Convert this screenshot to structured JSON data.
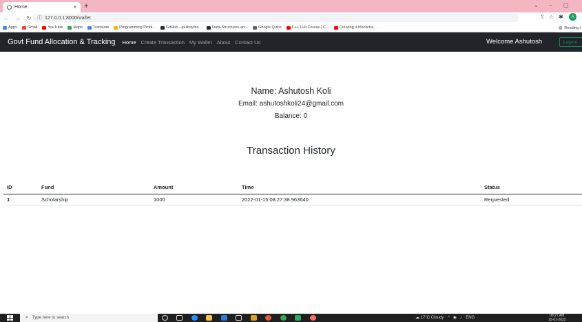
{
  "browser": {
    "tab_title": "Home",
    "tab_close": "×",
    "new_tab": "+",
    "url": "127.0.0.1:8000/wallet",
    "bookmarks": [
      {
        "label": "Apps",
        "color": "#4285f4"
      },
      {
        "label": "Gmail",
        "color": "#ea4335"
      },
      {
        "label": "YouTube",
        "color": "#ff0000"
      },
      {
        "label": "Maps",
        "color": "#34a853"
      },
      {
        "label": "Translate",
        "color": "#4285f4"
      },
      {
        "label": "Programming Probl...",
        "color": "#f4b400"
      },
      {
        "label": "GitHub - qiulbsy/bs...",
        "color": "#24292e"
      },
      {
        "label": "Data-Structures-an...",
        "color": "#24292e"
      },
      {
        "label": "Google Quick",
        "color": "#5f6368"
      },
      {
        "label": "C++ Full Course | C...",
        "color": "#ff0000"
      },
      {
        "label": "Creating a blockcha...",
        "color": "#ff0000"
      }
    ],
    "reading_list": "Reading l",
    "profile_initial": "A"
  },
  "navbar": {
    "brand": "Govt Fund Allocation & Tracking",
    "links": [
      "Home",
      "Create Transaction",
      "My Wallet",
      "About",
      "Contact Us"
    ],
    "welcome": "Welcome Ashutosh",
    "logout": "Logout"
  },
  "profile": {
    "name": "Name: Ashutosh Koli",
    "email": "Email: ashutoshkoli24@gmail.com",
    "balance": "Balance: 0"
  },
  "history": {
    "title": "Transaction History",
    "columns": [
      "ID",
      "Fund",
      "Amount",
      "Time",
      "Status"
    ],
    "rows": [
      [
        "1",
        "Scholarship",
        "1000",
        "2022-01-15 08:27:38.963640",
        "Requested"
      ]
    ]
  },
  "taskbar": {
    "search_placeholder": "Type here to search",
    "weather": "17°C Cloudy",
    "language": "ENG",
    "time": "08:27 AM",
    "date": "15-01-2022"
  }
}
